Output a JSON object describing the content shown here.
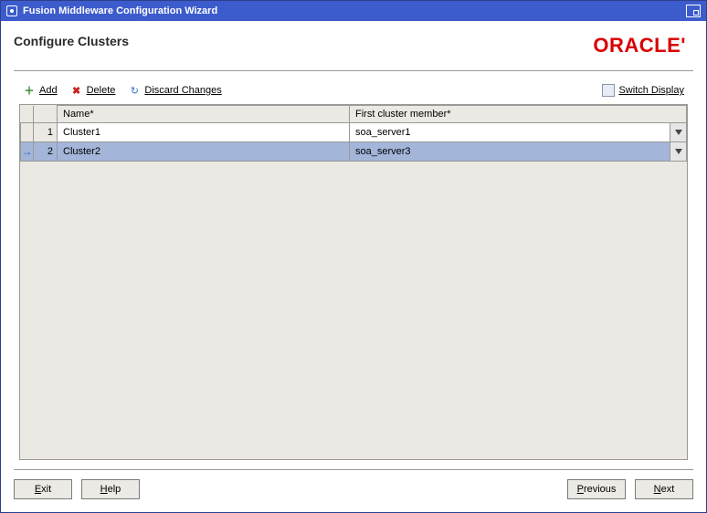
{
  "window": {
    "title": "Fusion Middleware Configuration Wizard"
  },
  "page": {
    "heading": "Configure Clusters",
    "brand": "ORACLE"
  },
  "toolbar": {
    "add": "Add",
    "delete": "Delete",
    "discard": "Discard Changes",
    "switch": "Switch Display"
  },
  "grid": {
    "columns": {
      "name": "Name*",
      "member": "First cluster member*"
    },
    "rows": [
      {
        "num": "1",
        "name": "Cluster1",
        "member": "soa_server1",
        "selected": false,
        "pointer": false
      },
      {
        "num": "2",
        "name": "Cluster2",
        "member": "soa_server3",
        "selected": true,
        "pointer": true
      }
    ]
  },
  "footer": {
    "exit": "Exit",
    "help": "Help",
    "previous": "Previous",
    "next": "Next"
  }
}
